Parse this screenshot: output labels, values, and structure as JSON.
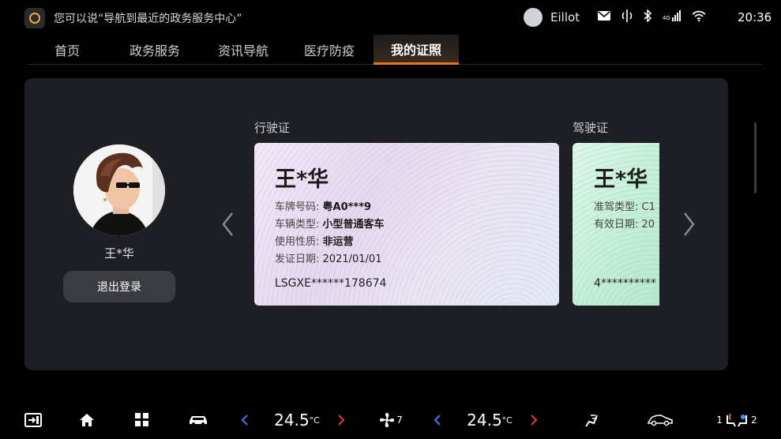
{
  "status": {
    "voice_hint": "您可以说“导航到最近的政务服务中心”",
    "user_name": "Eillot",
    "time": "20:36",
    "signal_label": "4G"
  },
  "tabs": [
    {
      "label": "首页"
    },
    {
      "label": "政务服务"
    },
    {
      "label": "资讯导航"
    },
    {
      "label": "医疗防疫"
    },
    {
      "label": "我的证照",
      "active": true
    }
  ],
  "profile": {
    "name": "王*华",
    "logout_label": "退出登录"
  },
  "vehicle_license": {
    "section_title": "行驶证",
    "name": "王*华",
    "rows": [
      {
        "label": "车牌号码:",
        "value": "粤A0***9"
      },
      {
        "label": "车辆类型:",
        "value": "小型普通客车"
      },
      {
        "label": "使用性质:",
        "value": "非运营"
      },
      {
        "label": "发证日期:",
        "value": "2021/01/01"
      }
    ],
    "vin": "LSGXE******178674"
  },
  "driver_license": {
    "section_title": "驾驶证",
    "name": "王*华",
    "rows": [
      {
        "label": "准驾类型:",
        "value": "C1"
      },
      {
        "label": "有效日期:",
        "value": "20"
      }
    ],
    "number": "4**********"
  },
  "dock": {
    "left_temp": "24.5",
    "right_temp": "24.5",
    "temp_unit": "°C",
    "fan_level": "7",
    "seat_left": "1",
    "seat_right": "2"
  },
  "colors": {
    "accent": "#e6761f",
    "chevron_left": "#3b7cf5",
    "chevron_right": "#e53935",
    "panel_bg": "#1e1f24"
  }
}
